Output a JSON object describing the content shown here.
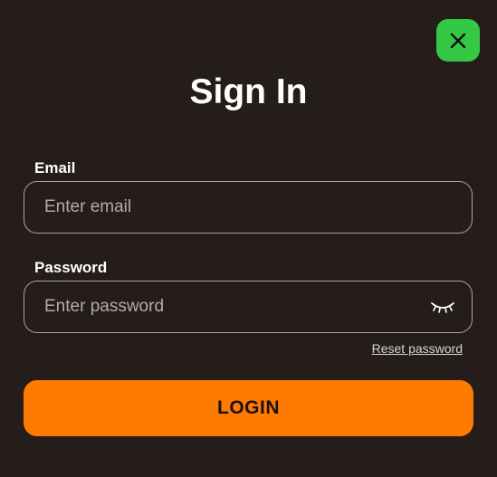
{
  "dialog": {
    "title": "Sign In",
    "close_icon": "close-icon"
  },
  "email": {
    "label": "Email",
    "placeholder": "Enter email",
    "value": ""
  },
  "password": {
    "label": "Password",
    "placeholder": "Enter password",
    "value": "",
    "toggle_icon": "eye-closed-icon"
  },
  "links": {
    "reset_password": "Reset password"
  },
  "actions": {
    "login_label": "LOGIN"
  },
  "colors": {
    "background": "#241d1a",
    "accent": "#ff7a00",
    "close_button": "#34c945"
  }
}
